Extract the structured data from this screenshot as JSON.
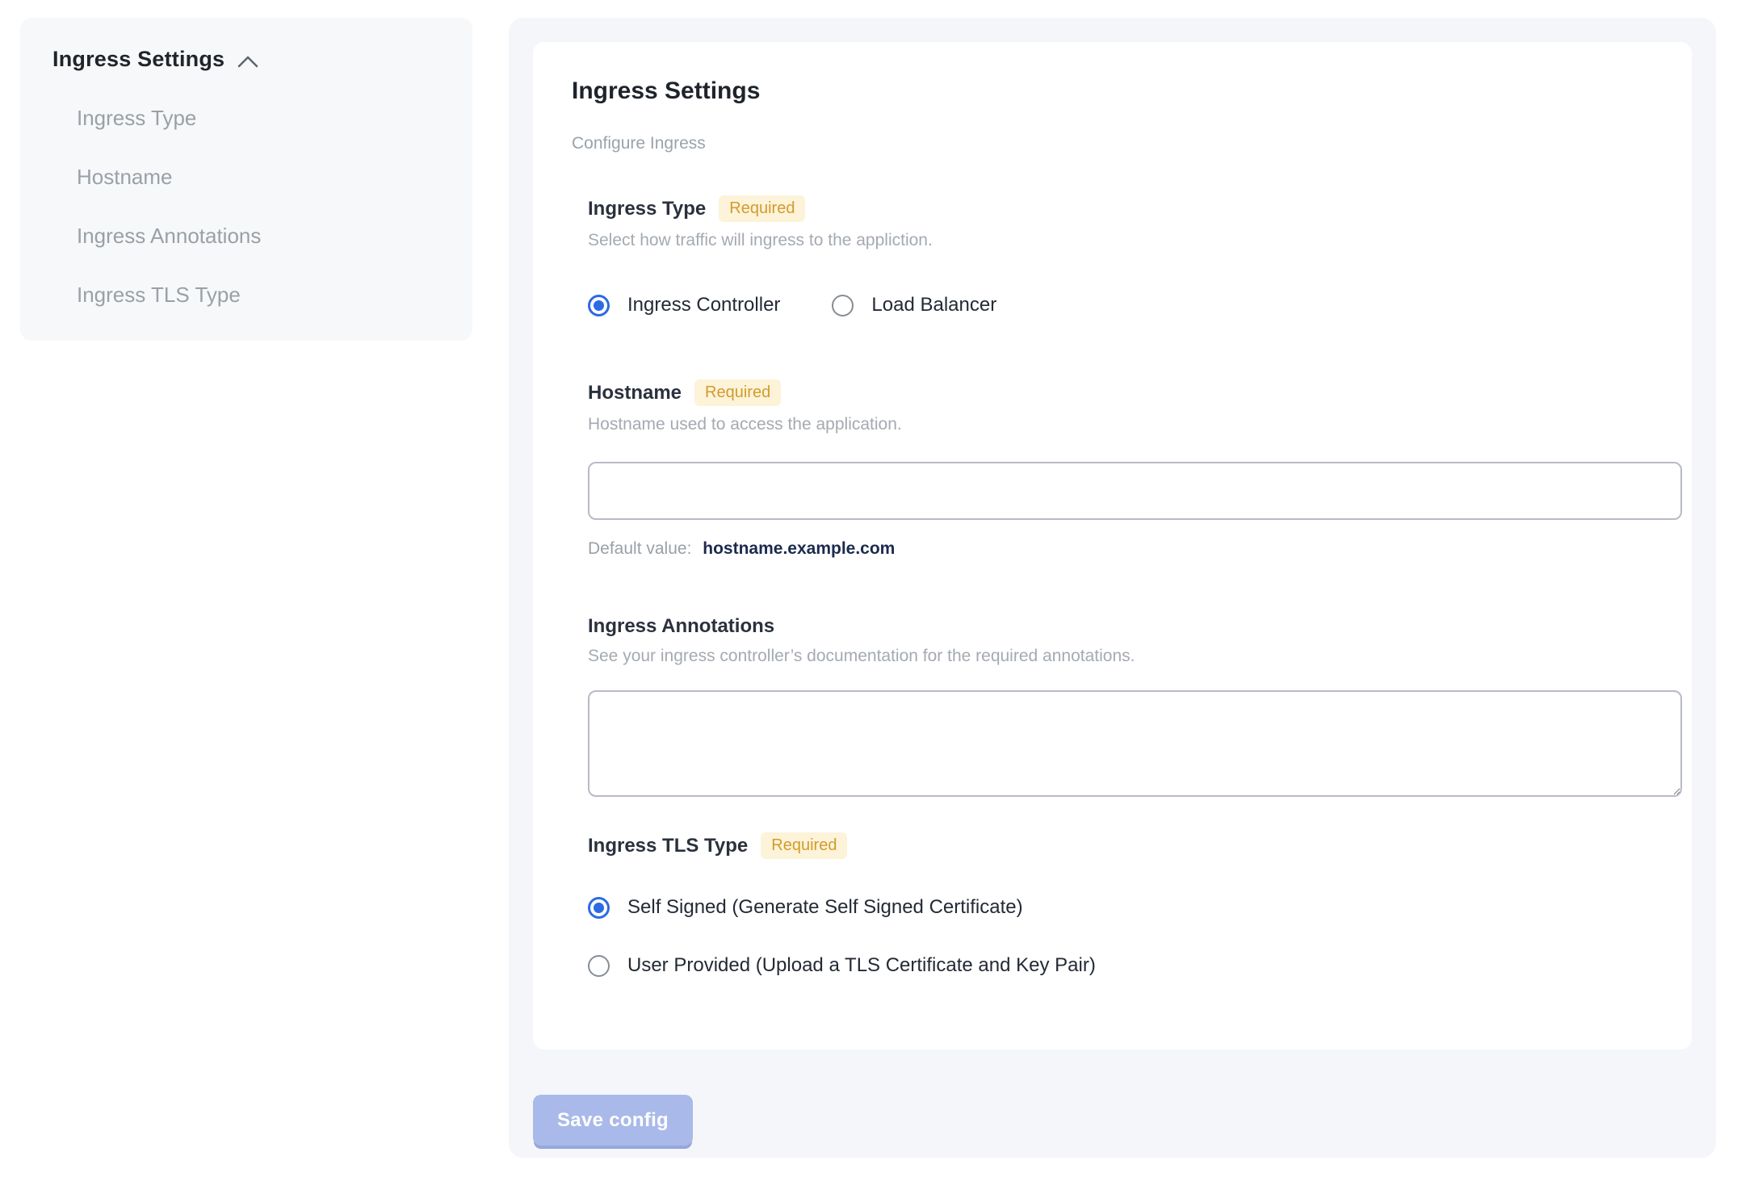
{
  "sidebar": {
    "header": "Ingress Settings",
    "collapse_icon": "chevron-up",
    "items": [
      {
        "label": "Ingress Type"
      },
      {
        "label": "Hostname"
      },
      {
        "label": "Ingress Annotations"
      },
      {
        "label": "Ingress TLS Type"
      }
    ]
  },
  "main": {
    "title": "Ingress Settings",
    "subtitle": "Configure Ingress",
    "sections": {
      "ingress_type": {
        "label": "Ingress Type",
        "required_badge": "Required",
        "description": "Select how traffic will ingress to the appliction.",
        "options": [
          {
            "label": "Ingress Controller",
            "selected": true
          },
          {
            "label": "Load Balancer",
            "selected": false
          }
        ]
      },
      "hostname": {
        "label": "Hostname",
        "required_badge": "Required",
        "description": "Hostname used to access the application.",
        "input_value": "",
        "input_placeholder": "",
        "default_value_label": "Default value:",
        "default_value": "hostname.example.com"
      },
      "ingress_annotations": {
        "label": "Ingress Annotations",
        "description": "See your ingress controller’s documentation for the required annotations.",
        "textarea_value": "",
        "textarea_placeholder": ""
      },
      "ingress_tls_type": {
        "label": "Ingress TLS Type",
        "required_badge": "Required",
        "options": [
          {
            "label": "Self Signed (Generate Self Signed Certificate)",
            "selected": true
          },
          {
            "label": "User Provided (Upload a TLS Certificate and Key Pair)",
            "selected": false
          }
        ]
      }
    },
    "save_button_label": "Save config"
  },
  "colors": {
    "badge_bg": "#fcf3d9",
    "badge_text": "#d39b2c",
    "radio_selected": "#2d6ae4",
    "default_value_text": "#1c2a4e",
    "save_button_bg": "#a9b9e9",
    "panel_bg": "#f4f6f9",
    "sidebar_bg": "#f7f8f9"
  }
}
